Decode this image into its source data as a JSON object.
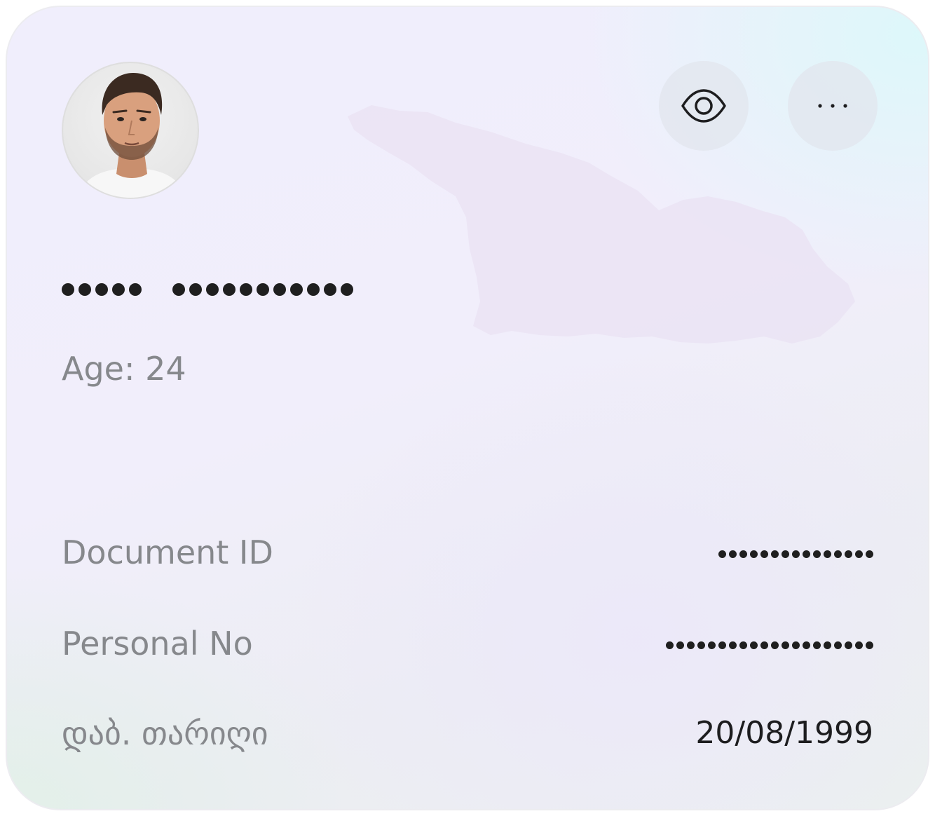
{
  "card": {
    "avatar_alt": "Profile photo",
    "name_first_mask_count": 5,
    "name_last_mask_count": 11,
    "age_text": "Age: 24",
    "actions": {
      "view_icon": "eye-icon",
      "more_icon": "more-horizontal-icon"
    },
    "rows": [
      {
        "label": "Document ID",
        "masked": true,
        "mask_count": 15
      },
      {
        "label": "Personal No",
        "masked": true,
        "mask_count": 20
      },
      {
        "label": "დაბ. თარიღი",
        "masked": false,
        "value": "20/08/1999"
      }
    ]
  }
}
